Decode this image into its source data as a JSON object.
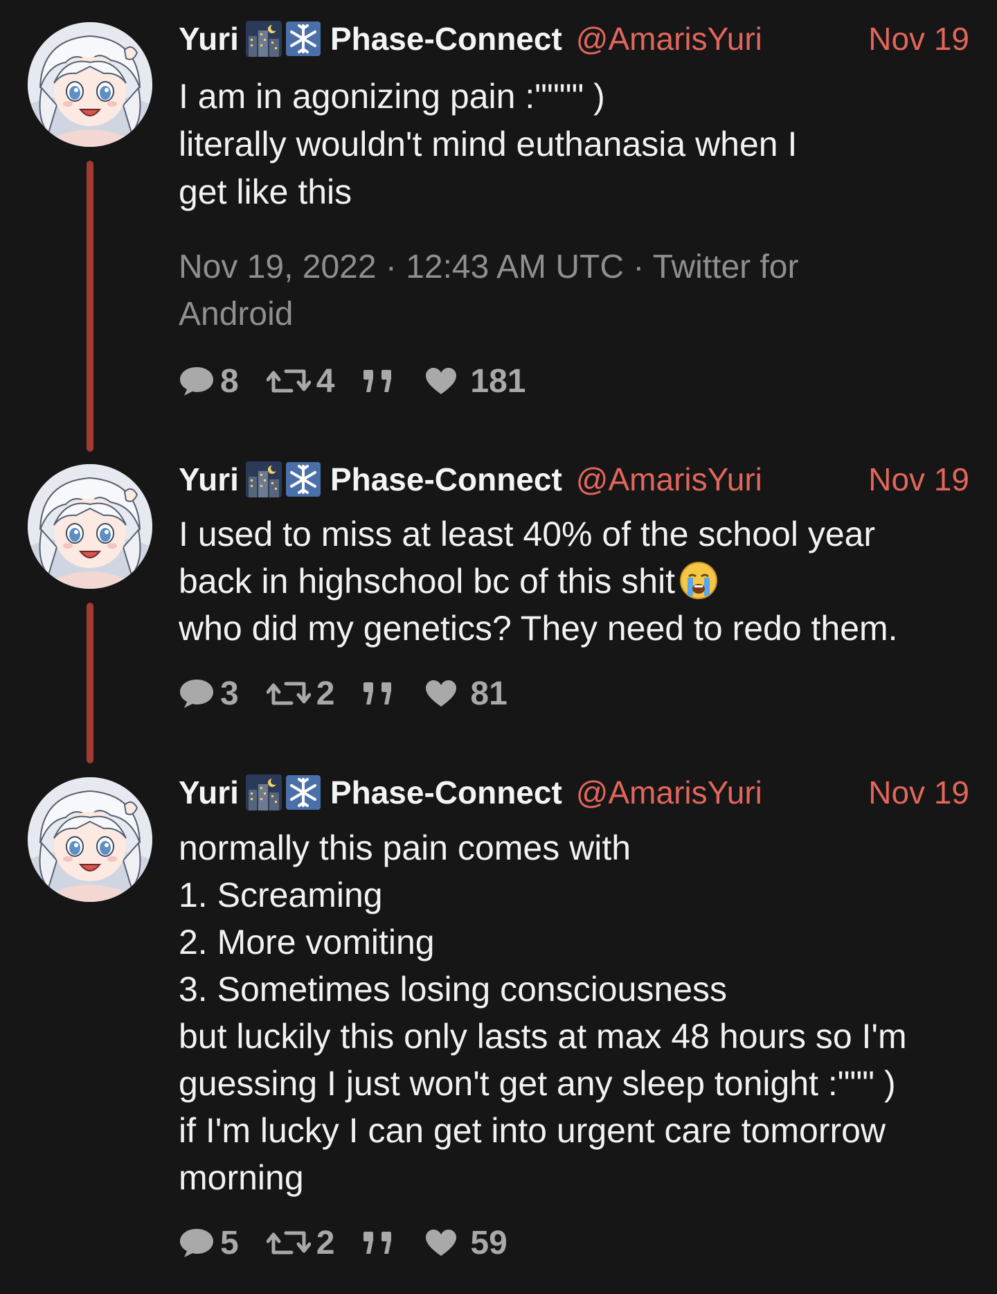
{
  "tweets": [
    {
      "display_name": "Yuri",
      "name_emojis": [
        "night-city-icon",
        "snowflake-icon"
      ],
      "name_suffix": "Phase-Connect",
      "handle": "@AmarisYuri",
      "date": "Nov 19",
      "lines": [
        "I am in agonizing pain :\"\"\"\" )",
        "literally wouldn't mind euthanasia when I",
        "get like this"
      ],
      "timestamp_lines": [
        "Nov 19, 2022 · 12:43 AM UTC · Twitter for",
        "Android"
      ],
      "stats": {
        "replies": "8",
        "retweets": "4",
        "likes": "181"
      }
    },
    {
      "display_name": "Yuri",
      "name_emojis": [
        "night-city-icon",
        "snowflake-icon"
      ],
      "name_suffix": "Phase-Connect",
      "handle": "@AmarisYuri",
      "date": "Nov 19",
      "lines": [
        "I used to miss at least 40% of the school year",
        "back in highschool bc of this shit",
        "who did my genetics? They need to redo them."
      ],
      "inline_emoji": "loudly-crying-face-icon",
      "stats": {
        "replies": "3",
        "retweets": "2",
        "likes": "81"
      }
    },
    {
      "display_name": "Yuri",
      "name_emojis": [
        "night-city-icon",
        "snowflake-icon"
      ],
      "name_suffix": "Phase-Connect",
      "handle": "@AmarisYuri",
      "date": "Nov 19",
      "lines": [
        "normally this pain comes with",
        "1. Screaming",
        "2. More vomiting",
        "3. Sometimes losing consciousness",
        "but luckily this only lasts at max 48 hours so I'm",
        "guessing I just won't get any sleep tonight :\"\"\" )",
        "if I'm lucky I can get into urgent care tomorrow",
        "morning"
      ],
      "stats": {
        "replies": "5",
        "retweets": "2",
        "likes": "59"
      }
    }
  ],
  "colors": {
    "background": "#161616",
    "accent": "#e2665c",
    "thread_line": "#a23a34",
    "muted": "#8f8f8f"
  }
}
